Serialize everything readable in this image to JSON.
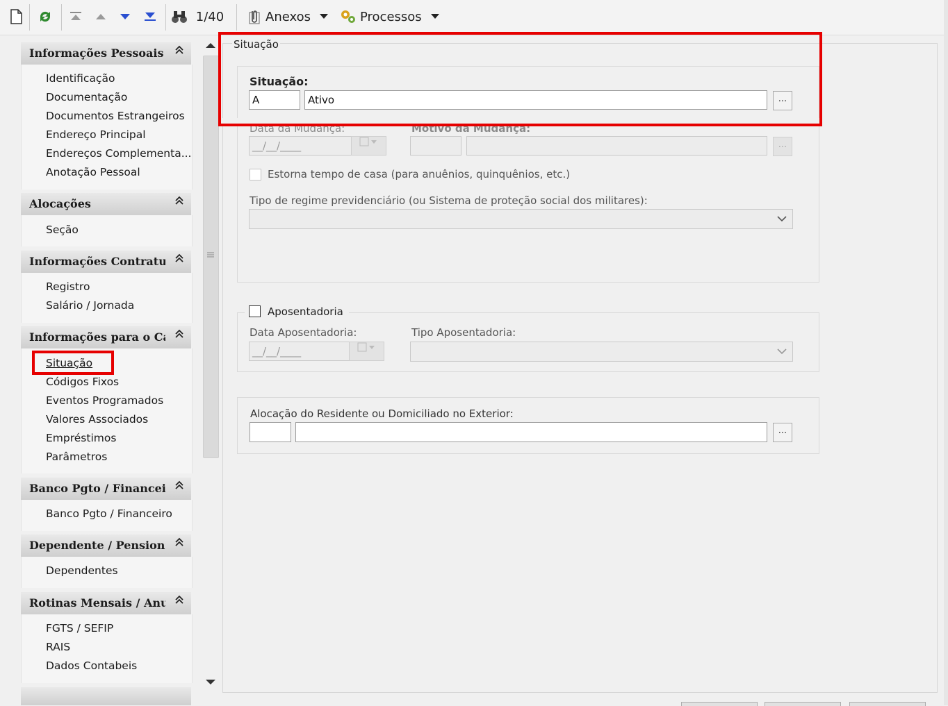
{
  "toolbar": {
    "record_counter": "1/40",
    "attachments_label": "Anexos",
    "processes_label": "Processos",
    "icons": [
      "new-icon",
      "refresh-icon",
      "first-record-icon",
      "previous-record-icon",
      "next-record-icon",
      "last-record-icon",
      "binoculars-icon",
      "paperclip-icon",
      "gears-icon"
    ]
  },
  "sidebar": {
    "groups": [
      {
        "title": "Informações Pessoais",
        "items": [
          "Identificação",
          "Documentação",
          "Documentos Estrangeiros",
          "Endereço Principal",
          "Endereços Complementa...",
          "Anotação Pessoal"
        ]
      },
      {
        "title": "Alocações",
        "items": [
          "Seção"
        ]
      },
      {
        "title": "Informações Contratua",
        "items": [
          "Registro",
          "Salário / Jornada"
        ]
      },
      {
        "title": "Informações para o Cál",
        "items": [
          "Situação",
          "Códigos Fixos",
          "Eventos Programados",
          "Valores Associados",
          "Empréstimos",
          "Parâmetros"
        ]
      },
      {
        "title": "Banco Pgto / Financeiro",
        "items": [
          "Banco Pgto / Financeiro"
        ]
      },
      {
        "title": "Dependente / Pensionis",
        "items": [
          "Dependentes"
        ]
      },
      {
        "title": "Rotinas Mensais / Anua",
        "items": [
          "FGTS / SEFIP",
          "RAIS",
          "Dados Contabeis"
        ]
      }
    ],
    "selected_item": "Situação"
  },
  "form": {
    "section_title": "Situação",
    "situacao_label": "Situação:",
    "situacao_code": "A",
    "situacao_desc": "Ativo",
    "lookup_button": "...",
    "data_mudanca_label": "Data da Mudança:",
    "date_mask": "__/__/____",
    "motivo_label": "Motivo da Mudança:",
    "estorna_label": "Estorna tempo de casa (para anuênios, quinquênios, etc.)",
    "regime_label": "Tipo de regime previdenciário (ou Sistema de proteção social dos militares):",
    "aposentadoria_label": "Aposentadoria",
    "data_aposentadoria_label": "Data Aposentadoria:",
    "tipo_aposentadoria_label": "Tipo Aposentadoria:",
    "alocacao_label": "Alocação do Residente ou Domiciliado no Exterior:"
  },
  "colors": {
    "highlight_red": "#e60000"
  }
}
